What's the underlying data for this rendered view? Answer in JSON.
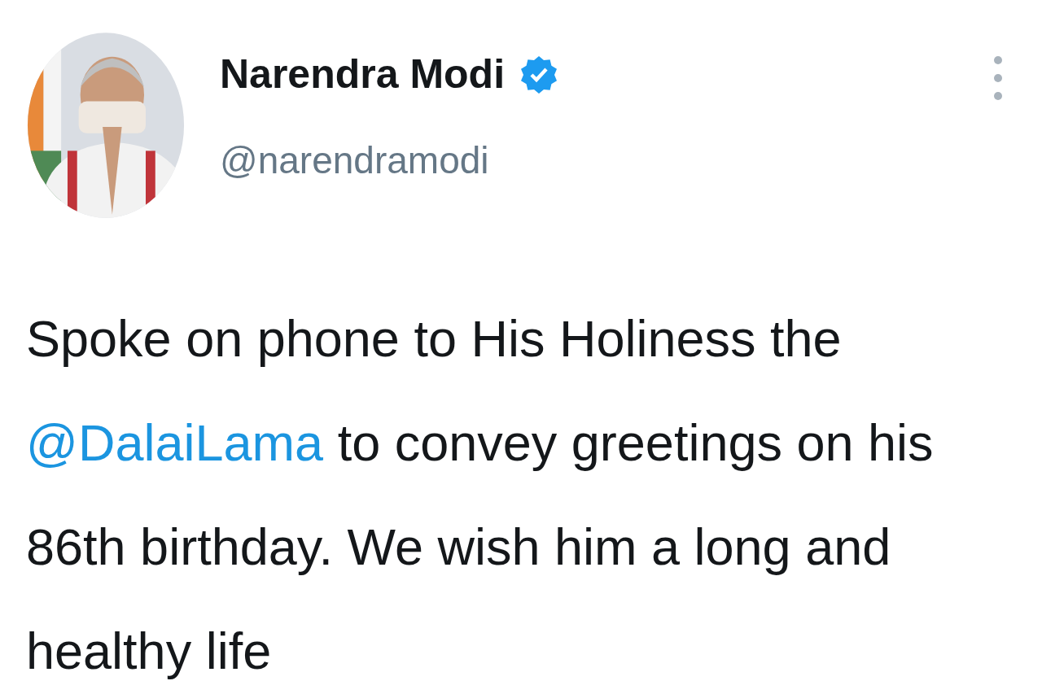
{
  "author": {
    "name": "Narendra Modi",
    "verified": true,
    "handle": "@narendramodi"
  },
  "tweet": {
    "parts": [
      {
        "kind": "text",
        "text": "Spoke on phone to His Holiness the "
      },
      {
        "kind": "mention",
        "text": "@DalaiLama"
      },
      {
        "kind": "text",
        "text": " to convey greetings on his 86th birthday. We wish him a long and healthy life"
      }
    ]
  }
}
